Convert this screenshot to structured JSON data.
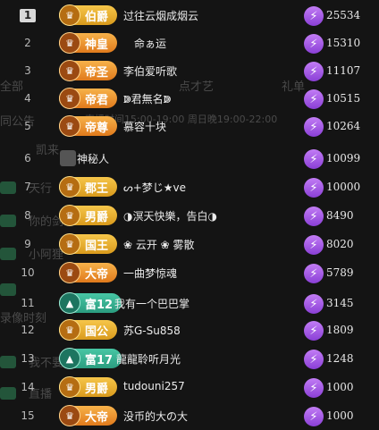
{
  "background": {
    "texts": [
      "全部",
      "点才艺",
      "礼单",
      "同公告",
      "直播时间15:00-19:00 周日晚19:00-22:00",
      "凯来",
      "天行",
      "你的剑",
      "小阿狸",
      "录像时刻",
      "我不要",
      "直播"
    ]
  },
  "leaderboard": [
    {
      "rank": "1",
      "badge": "伯爵",
      "name": "过往云烟成烟云",
      "value": "25534"
    },
    {
      "rank": "2",
      "badge": "神皇",
      "name": "命ぁ运",
      "value": "15310"
    },
    {
      "rank": "3",
      "badge": "帝圣",
      "name": "李伯爱听歌",
      "value": "11107"
    },
    {
      "rank": "4",
      "badge": "帝君",
      "name": "ↇ君無名ↇ",
      "value": "10515"
    },
    {
      "rank": "5",
      "badge": "帝尊",
      "name": "慕容十块",
      "value": "10264"
    },
    {
      "rank": "6",
      "badge": "",
      "name": "神秘人",
      "value": "10099"
    },
    {
      "rank": "7",
      "badge": "郡王",
      "name": "ᔕ+梦じ★ve",
      "value": "10000"
    },
    {
      "rank": "8",
      "badge": "男爵",
      "name": "◑溟天快樂，告白◑",
      "value": "8490"
    },
    {
      "rank": "9",
      "badge": "国王",
      "name": "❀ 云开 ❀ 雾散",
      "value": "8020"
    },
    {
      "rank": "10",
      "badge": "大帝",
      "name": "一曲梦惊魂",
      "value": "5789"
    },
    {
      "rank": "11",
      "badge": "富12",
      "name": "我有一个巴巴掌",
      "value": "3145"
    },
    {
      "rank": "12",
      "badge": "国公",
      "name": "苏G-Su858",
      "value": "1809"
    },
    {
      "rank": "13",
      "badge": "富17",
      "name": "龍龍聆听月光",
      "value": "1248"
    },
    {
      "rank": "14",
      "badge": "男爵",
      "name": "tudouni257",
      "value": "1000"
    },
    {
      "rank": "15",
      "badge": "大帝",
      "name": "没币的大の大",
      "value": "1000"
    }
  ],
  "colors": {
    "gift": "#a35ae6",
    "badge_gold": "#eab03a",
    "badge_green": "#3bb492"
  }
}
